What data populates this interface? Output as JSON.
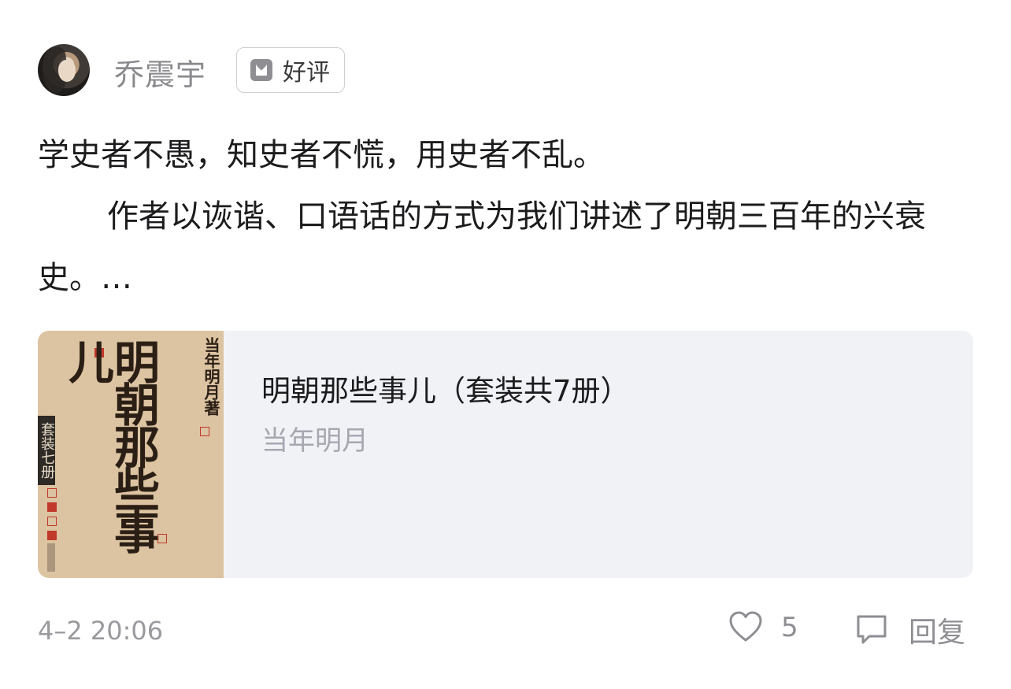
{
  "user": {
    "name": "乔震宇",
    "rating_label": "好评"
  },
  "review": {
    "line1": "学史者不愚，知史者不慌，用史者不乱。",
    "line2": "作者以诙谐、口语话的方式为我们讲述了明朝三百年的兴衰史。…"
  },
  "book": {
    "title": "明朝那些事儿（套装共7册）",
    "author": "当年明月",
    "cover_title": "明朝那些事儿",
    "cover_author": "当年明月",
    "cover_author_suffix": "著",
    "cover_set_label": "套装七册"
  },
  "footer": {
    "timestamp": "4–2 20:06",
    "like_count": "5",
    "reply_label": "回复"
  },
  "icons": {
    "rating": "thumbs-check-icon",
    "like": "heart-outline-icon",
    "reply": "comment-bubble-icon"
  },
  "colors": {
    "card_bg": "#f1f2f6",
    "muted_text": "#8e8e93",
    "cover_bg": "#dcc3a1"
  }
}
